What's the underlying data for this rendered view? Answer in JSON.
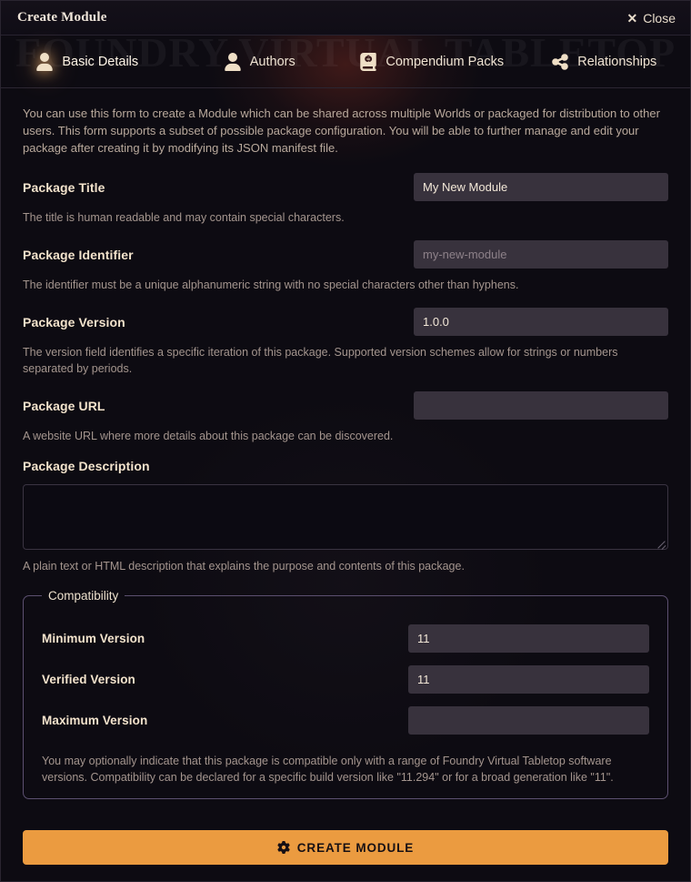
{
  "window": {
    "title": "Create Module",
    "close_label": "Close",
    "close_icon": "close-x-icon",
    "watermark": "FOUNDRY VIRTUAL TABLETOP"
  },
  "tabs": [
    {
      "label": "Basic Details",
      "icon": "user-icon",
      "active": true
    },
    {
      "label": "Authors",
      "icon": "user-icon",
      "active": false
    },
    {
      "label": "Compendium Packs",
      "icon": "atlas-icon",
      "active": false
    },
    {
      "label": "Relationships",
      "icon": "share-nodes-icon",
      "active": false
    }
  ],
  "intro": "You can use this form to create a Module which can be shared across multiple Worlds or packaged for distribution to other users. This form supports a subset of possible package configuration. You will be able to further manage and edit your package after creating it by modifying its JSON manifest file.",
  "fields": [
    {
      "label": "Package Title",
      "value": "My New Module",
      "placeholder": "",
      "hint": "The title is human readable and may contain special characters."
    },
    {
      "label": "Package Identifier",
      "value": "",
      "placeholder": "my-new-module",
      "hint": "The identifier must be a unique alphanumeric string with no special characters other than hyphens."
    },
    {
      "label": "Package Version",
      "value": "1.0.0",
      "placeholder": "",
      "hint": "The version field identifies a specific iteration of this package. Supported version schemes allow for strings or numbers separated by periods."
    },
    {
      "label": "Package URL",
      "value": "",
      "placeholder": "",
      "hint": "A website URL where more details about this package can be discovered."
    }
  ],
  "description": {
    "label": "Package Description",
    "value": "",
    "placeholder": "",
    "hint": "A plain text or HTML description that explains the purpose and contents of this package."
  },
  "compatibility": {
    "legend": "Compatibility",
    "rows": [
      {
        "label": "Minimum Version",
        "value": "11",
        "placeholder": ""
      },
      {
        "label": "Verified Version",
        "value": "11",
        "placeholder": ""
      },
      {
        "label": "Maximum Version",
        "value": "",
        "placeholder": ""
      }
    ],
    "note": "You may optionally indicate that this package is compatible only with a range of Foundry Virtual Tabletop software versions. Compatibility can be declared for a specific build version like \"11.294\" or for a broad generation like \"11\"."
  },
  "submit": {
    "label": "CREATE MODULE",
    "icon": "gear-icon"
  },
  "colors": {
    "accent": "#eb9b40",
    "window_bg": "#0d0b12",
    "input_bg": "#38323d",
    "label_text": "#f3e3cc",
    "hint_text": "#a4958e",
    "fieldset_border": "#5c5070"
  }
}
